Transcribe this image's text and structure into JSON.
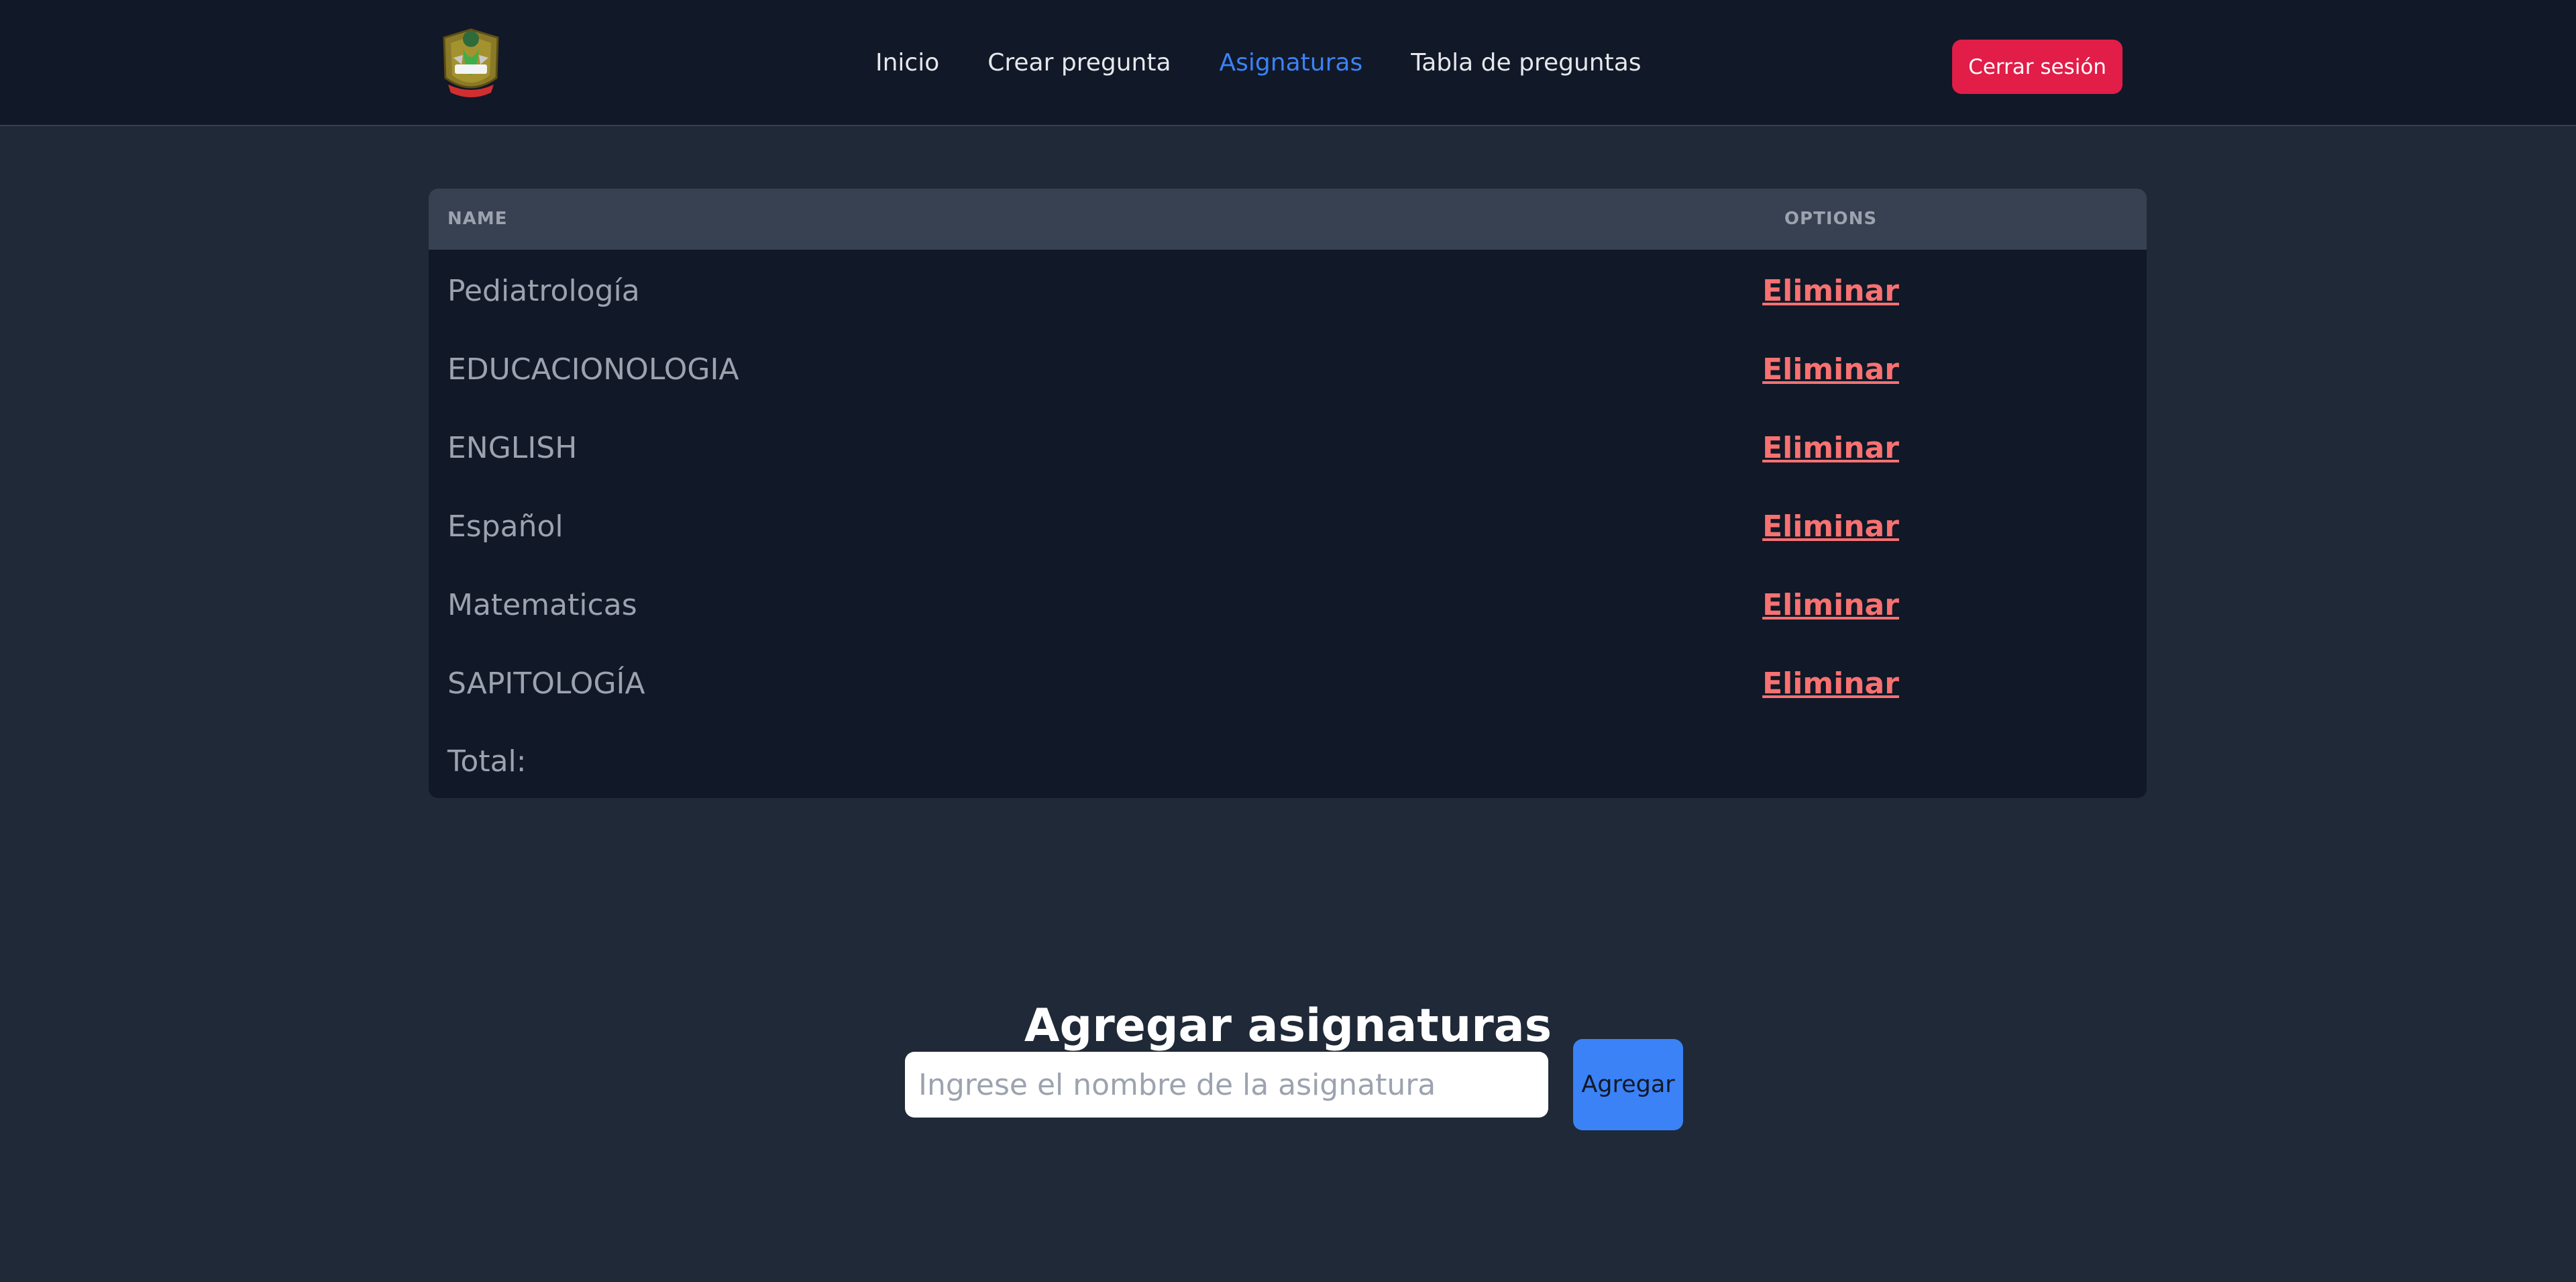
{
  "nav": {
    "links": [
      {
        "label": "Inicio"
      },
      {
        "label": "Crear pregunta"
      },
      {
        "label": "Asignaturas",
        "active": true
      },
      {
        "label": "Tabla de preguntas"
      }
    ],
    "logout_label": "Cerrar sesión"
  },
  "table": {
    "headers": {
      "name": "NAME",
      "options": "OPTIONS"
    },
    "rows": [
      {
        "name": "Pediatrología",
        "action": "Eliminar"
      },
      {
        "name": "EDUCACIONOLOGIA",
        "action": "Eliminar"
      },
      {
        "name": "ENGLISH",
        "action": "Eliminar"
      },
      {
        "name": "Español",
        "action": "Eliminar"
      },
      {
        "name": "Matematicas",
        "action": "Eliminar"
      },
      {
        "name": "SAPITOLOGÍA",
        "action": "Eliminar"
      }
    ],
    "total_label": "Total:"
  },
  "add_form": {
    "title": "Agregar asignaturas",
    "input_value": "",
    "input_placeholder": "Ingrese el nombre de la asignatura",
    "button_label": "Agregar"
  },
  "colors": {
    "navbar_bg": "#111827",
    "page_bg": "#1f2937",
    "active_link": "#3b82f6",
    "logout_button": "#e11d48",
    "delete_link": "#f87171",
    "add_button": "#3b82f6"
  },
  "icons": {
    "logo": "university-crest-logo"
  }
}
